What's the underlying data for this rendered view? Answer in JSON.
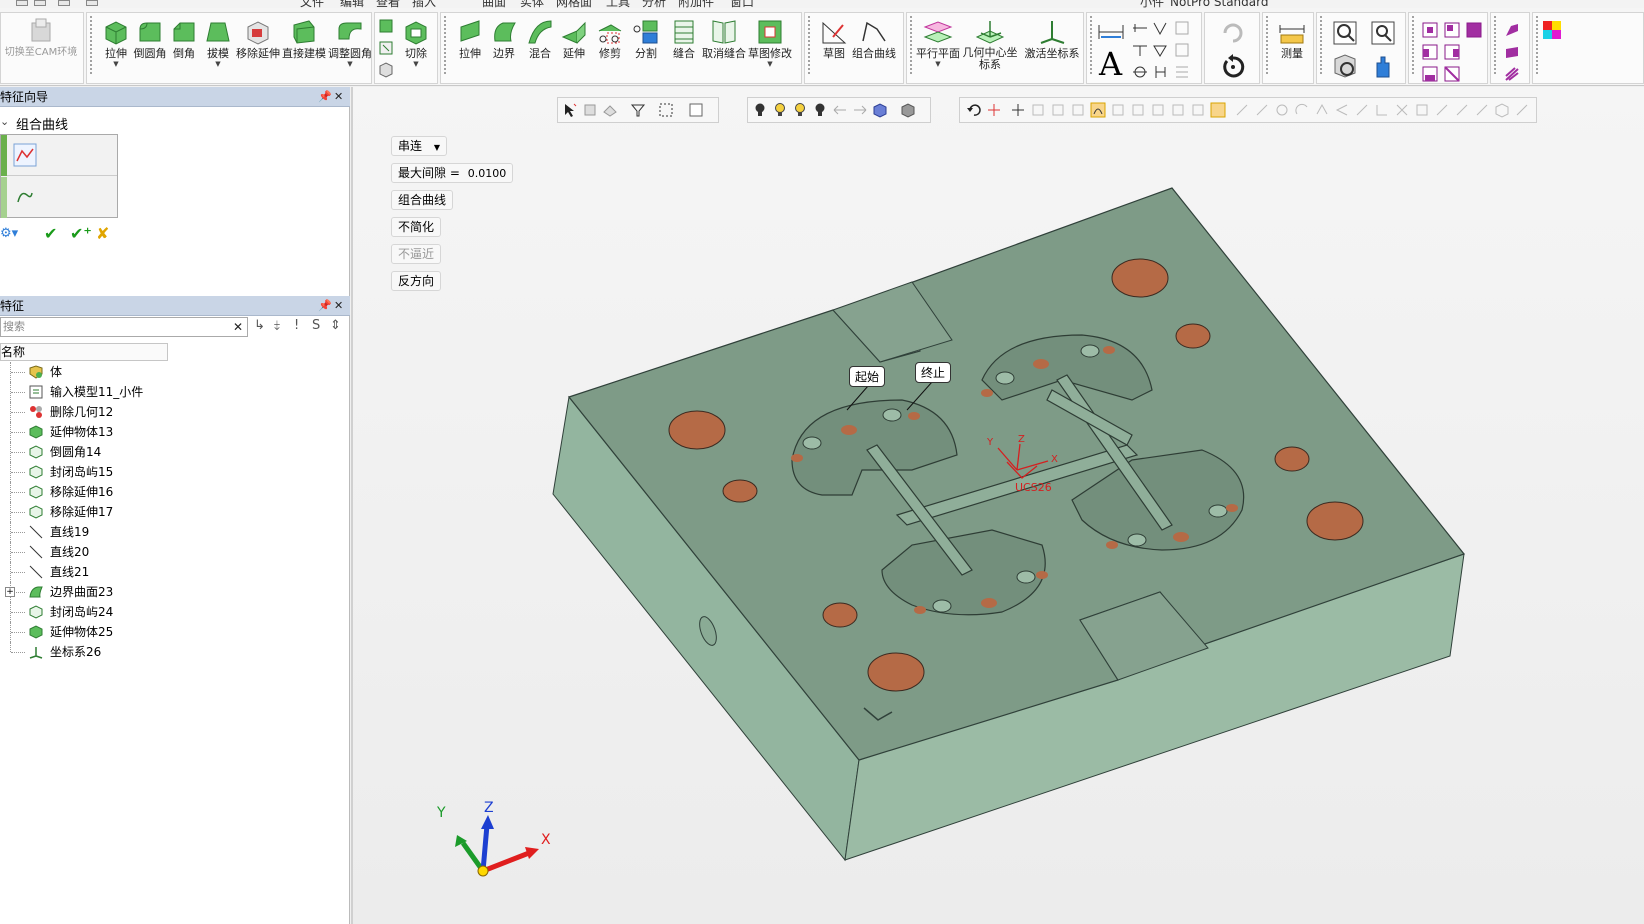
{
  "menubar": {
    "items": [
      "文件",
      "编辑",
      "查看",
      "插入",
      "曲面",
      "实体",
      "网格面",
      "工具",
      "分析",
      "附加件",
      "窗口"
    ],
    "window_title": "小件_NotPro Standard"
  },
  "ribbon": {
    "cam_switch": "切换至CAM环境",
    "groups": {
      "solid": [
        "拉伸",
        "倒圆角",
        "倒角",
        "拔模",
        "移除延伸",
        "直接建模",
        "调整圆角"
      ],
      "cut": "切除",
      "surface": [
        "拉伸",
        "边界",
        "混合",
        "延伸",
        "修剪",
        "分割",
        "缝合",
        "取消缝合",
        "草图修改"
      ],
      "sketch": [
        "草图",
        "组合曲线"
      ],
      "datum": [
        "平行平面",
        "几何中心坐标系",
        "激活坐标系"
      ],
      "measure": "测量"
    }
  },
  "wizard": {
    "title": "特征向导",
    "subtitle": "组合曲线"
  },
  "features": {
    "title": "特征",
    "search_placeholder": "搜索",
    "column_name": "名称",
    "items": [
      {
        "label": "体",
        "icon": "bodies-icon"
      },
      {
        "label": "输入模型11_小件",
        "icon": "import-model-icon"
      },
      {
        "label": "删除几何12",
        "icon": "delete-geometry-icon"
      },
      {
        "label": "延伸物体13",
        "icon": "extend-body-icon"
      },
      {
        "label": "倒圆角14",
        "icon": "fillet-icon"
      },
      {
        "label": "封闭岛屿15",
        "icon": "close-island-icon"
      },
      {
        "label": "移除延伸16",
        "icon": "remove-extension-icon"
      },
      {
        "label": "移除延伸17",
        "icon": "remove-extension-icon"
      },
      {
        "label": "直线19",
        "icon": "line-icon"
      },
      {
        "label": "直线20",
        "icon": "line-icon"
      },
      {
        "label": "直线21",
        "icon": "line-icon"
      },
      {
        "label": "边界曲面23",
        "icon": "boundary-surface-icon"
      },
      {
        "label": "封闭岛屿24",
        "icon": "close-island-icon"
      },
      {
        "label": "延伸物体25",
        "icon": "extend-body-icon"
      },
      {
        "label": "坐标系26",
        "icon": "coordinate-system-icon"
      }
    ]
  },
  "viewport": {
    "options": {
      "mode": "串连",
      "max_gap_label": "最大间隙 =",
      "max_gap_value": "0.0100",
      "compose": "组合曲线",
      "no_simplify": "不简化",
      "no_approx": "不逼近",
      "reverse": "反方向"
    },
    "callouts": {
      "start": "起始",
      "end": "终止"
    },
    "ucs": {
      "name": "UCS26",
      "x": "X",
      "y": "Y",
      "z": "Z"
    },
    "triad": {
      "x": "X",
      "y": "Y",
      "z": "Z"
    },
    "colors": {
      "part": "#7f9c88",
      "part_side": "#9bbba5",
      "part_dark": "#6d8a77",
      "holes": "#b56a46"
    }
  }
}
